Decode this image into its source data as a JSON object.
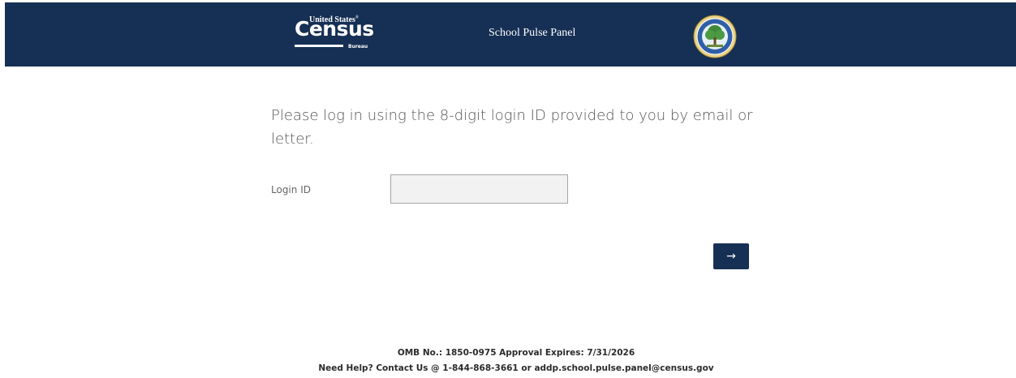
{
  "header": {
    "logo": {
      "top_text": "United States",
      "registered": "®",
      "name": "Census",
      "sub_text": "Bureau"
    },
    "title": "School Pulse Panel",
    "seal_icon": "department-of-education-seal"
  },
  "main": {
    "instructions": "Please log in using the 8-digit login ID provided to you by email or letter.",
    "login_label": "Login ID",
    "login_value": "",
    "submit_label": "→"
  },
  "footer": {
    "omb_line": "OMB No.: 1850-0975 Approval Expires: 7/31/2026",
    "help_line": "Need Help? Contact Us @ 1-844-868-3661 or addp.school.pulse.panel@census.gov"
  },
  "colors": {
    "brand_navy": "#162f54",
    "input_bg": "#f2f2f2",
    "text_gray": "#555555"
  }
}
